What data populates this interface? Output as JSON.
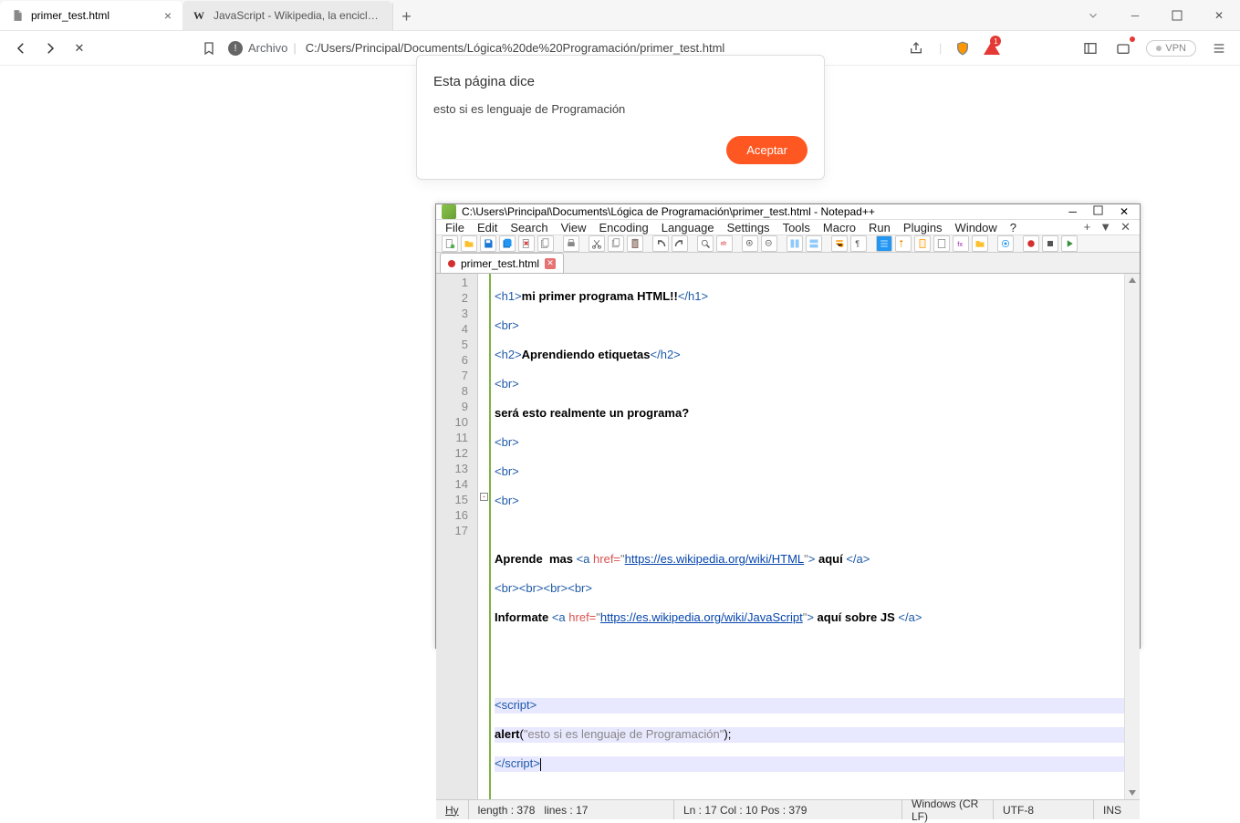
{
  "browser": {
    "tabs": [
      {
        "title": "primer_test.html",
        "active": true,
        "favicon": "file"
      },
      {
        "title": "JavaScript - Wikipedia, la enciclopedia",
        "active": false,
        "favicon": "W"
      }
    ],
    "address": {
      "kind_label": "Archivo",
      "url": "C:/Users/Principal/Documents/Lógica%20de%20Programación/primer_test.html"
    },
    "right": {
      "vpn": "VPN",
      "shield_badge": "1"
    }
  },
  "dialog": {
    "title": "Esta página dice",
    "message": "esto si es lenguaje de Programación",
    "accept": "Aceptar"
  },
  "npp": {
    "titlebar": "C:\\Users\\Principal\\Documents\\Lógica de Programación\\primer_test.html - Notepad++",
    "menu": [
      "File",
      "Edit",
      "Search",
      "View",
      "Encoding",
      "Language",
      "Settings",
      "Tools",
      "Macro",
      "Run",
      "Plugins",
      "Window",
      "?"
    ],
    "tab": "primer_test.html",
    "lines": {
      "l1_txt": "mi primer programa HTML!!",
      "l3_txt": "Aprendiendo etiquetas",
      "l5_txt": "será esto realmente un programa?",
      "l10_pre": "Aprende  mas ",
      "l10_url": "https://es.wikipedia.org/wiki/HTML",
      "l10_post": " aquí ",
      "l12_pre": "Informate ",
      "l12_url": "https://es.wikipedia.org/wiki/JavaScript",
      "l12_post": " aquí sobre JS ",
      "l16_alert": "alert",
      "l16_str": "\"esto si es lenguaje de Programación\"",
      "l16_end": ";"
    },
    "status": {
      "hy": "Hy",
      "len": "length : 378",
      "lines": "lines : 17",
      "pos": "Ln : 17   Col : 10   Pos : 379",
      "eol": "Windows (CR LF)",
      "enc": "UTF-8",
      "mode": "INS"
    }
  }
}
